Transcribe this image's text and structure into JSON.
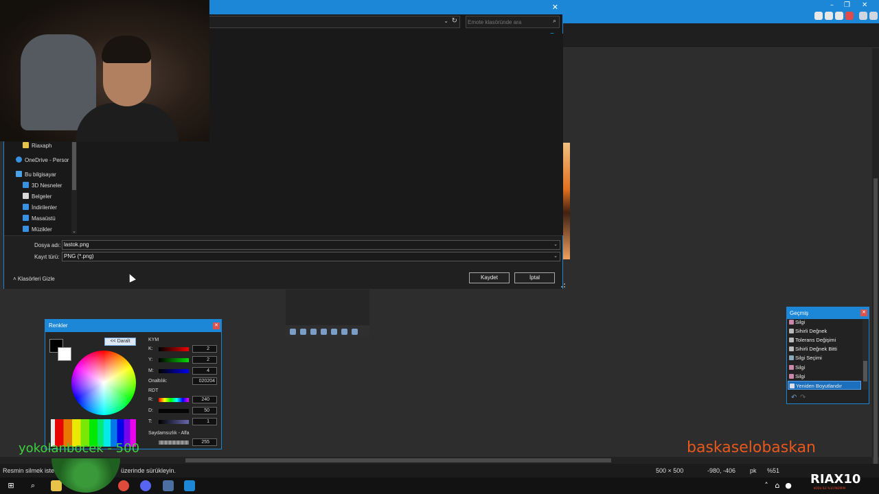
{
  "dialog": {
    "search_placeholder": "Emote klasöründe ara",
    "nav_items": [
      {
        "label": "Riaxaph",
        "icon": "folder-icon",
        "color": "#e8c34a"
      },
      {
        "label": "OneDrive - Persor",
        "icon": "cloud-icon",
        "color": "#3a8fe0"
      },
      {
        "label": "Bu bilgisayar",
        "icon": "computer-icon",
        "color": "#4aa3e8"
      },
      {
        "label": "3D Nesneler",
        "icon": "cube-icon",
        "color": "#3a8fe0"
      },
      {
        "label": "Belgeler",
        "icon": "document-icon",
        "color": "#d8d8d8"
      },
      {
        "label": "İndirilenler",
        "icon": "download-icon",
        "color": "#3a8fe0"
      },
      {
        "label": "Masaüstü",
        "icon": "desktop-icon",
        "color": "#3a8fe0"
      },
      {
        "label": "Müzikler",
        "icon": "music-icon",
        "color": "#3a8fe0"
      }
    ],
    "filename_label": "Dosya adı:",
    "filename_value": "lastok.png",
    "filetype_label": "Kayıt türü:",
    "filetype_value": "PNG (*.png)",
    "hide_folders": "Klasörleri Gizle",
    "save_button": "Kaydet",
    "cancel_button": "İptal"
  },
  "colors": {
    "title": "Renkler",
    "collapse_button": "<< Daralt",
    "kym_label": "KYM",
    "r_label": "K:",
    "r_value": "2",
    "g_label": "Y:",
    "g_value": "2",
    "b_label": "M:",
    "b_value": "4",
    "hex_label": "Onaltılık:",
    "hex_value": "020204",
    "rdt_label": "RDT",
    "h_label": "R:",
    "h_value": "240",
    "s_label": "D:",
    "s_value": "50",
    "v_label": "T:",
    "v_value": "1",
    "alpha_label": "Saydamsızlık - Alfa",
    "alpha_value": "255"
  },
  "history": {
    "title": "Geçmiş",
    "items": [
      {
        "label": "Silgi",
        "icon": "eraser-icon"
      },
      {
        "label": "Sihirli Değnek",
        "icon": "magic-wand-icon"
      },
      {
        "label": "Tolerans Değişimi",
        "icon": "magic-wand-icon"
      },
      {
        "label": "Sihirli Değnek Bitti",
        "icon": "magic-wand-icon"
      },
      {
        "label": "Silgi Seçimi",
        "icon": "selection-icon"
      },
      {
        "label": "Silgi",
        "icon": "eraser-icon"
      },
      {
        "label": "Silgi",
        "icon": "eraser-icon"
      },
      {
        "label": "Yeniden Boyutlandır",
        "icon": "resize-icon"
      }
    ],
    "selected_index": 7
  },
  "status": {
    "hint_left": "Resmin silmek iste",
    "hint_right": "üzerinde sürükleyin.",
    "image_size": "500 × 500",
    "cursor_pos": "-980, -406",
    "unit": "pk",
    "zoom": "%51"
  },
  "overlay": {
    "left_text": "yokolanbocek - 500",
    "right_text": "baskaselobaskan",
    "brand": "RIAX10",
    "brand_sub": "KODU İLE %10 İNDİRİM"
  },
  "accent_color": "#1c87d6"
}
